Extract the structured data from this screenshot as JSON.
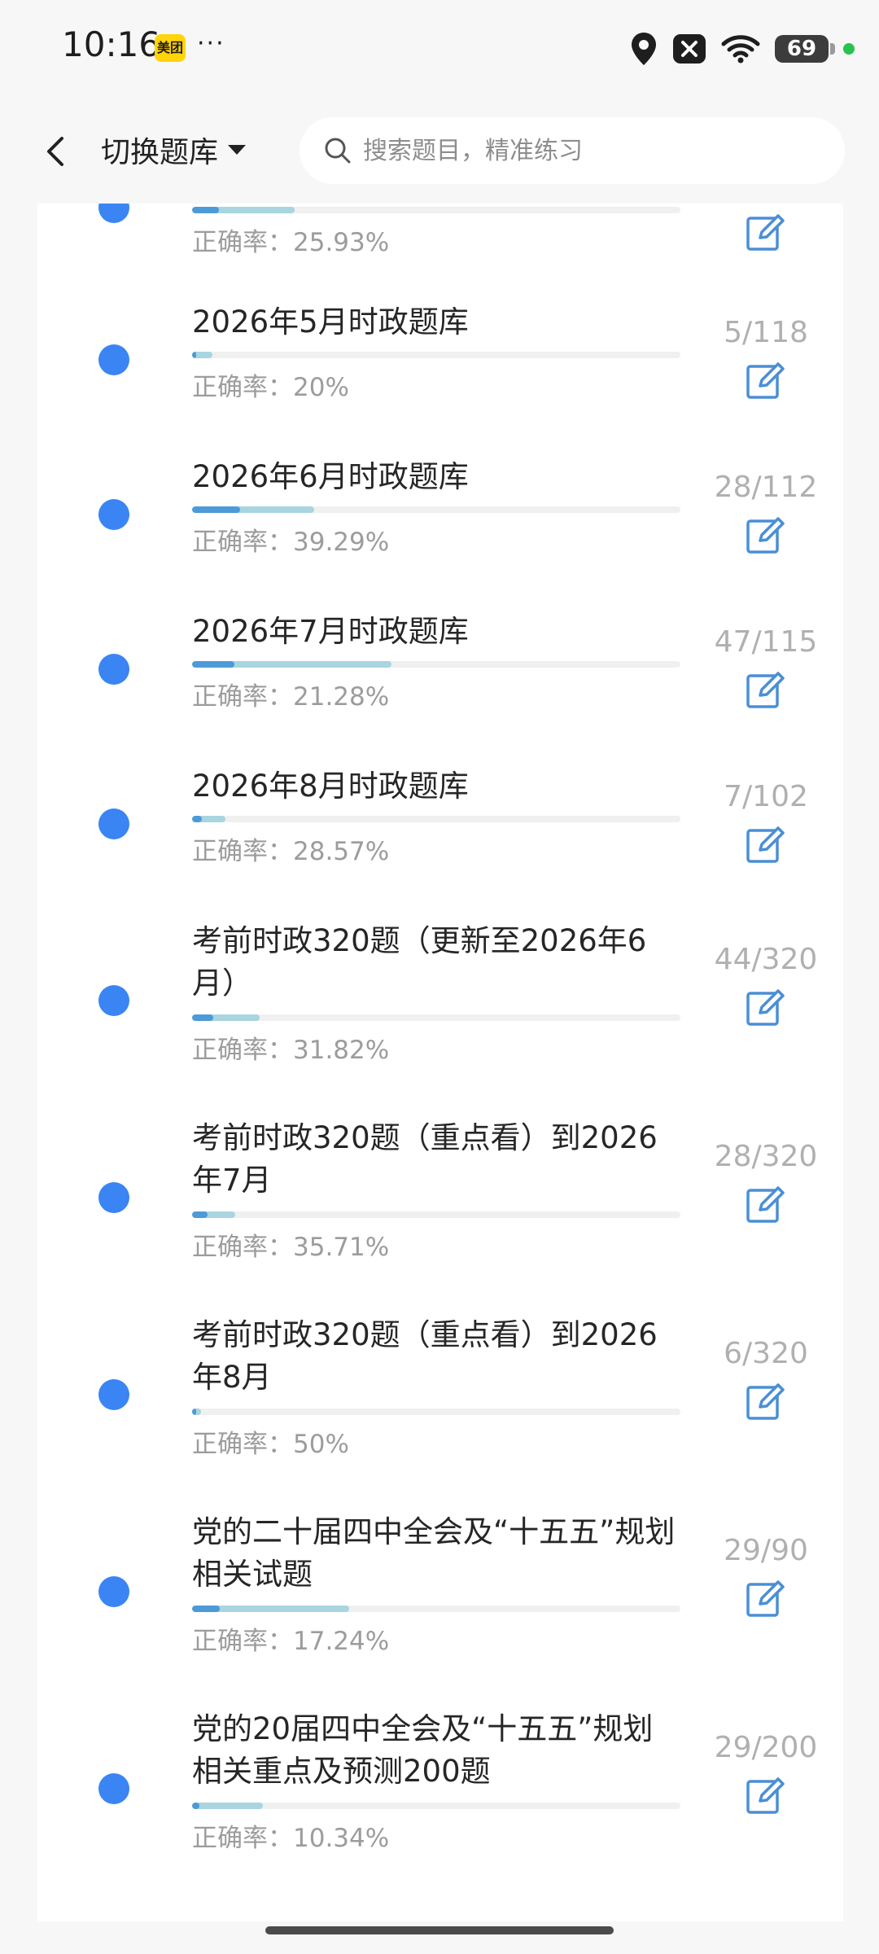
{
  "status_bar": {
    "time": "10:16",
    "app_badge": "美团",
    "more": "···",
    "battery": "69"
  },
  "top_bar": {
    "switch_label": "切换题库",
    "search_placeholder": "搜索题目，精准练习"
  },
  "accuracy_prefix": "正确率：",
  "items": [
    {
      "title": "",
      "accuracy": "25.93%",
      "count": ""
    },
    {
      "title": "2026年5月时政题库",
      "accuracy": "20%",
      "count": "5/118"
    },
    {
      "title": "2026年6月时政题库",
      "accuracy": "39.29%",
      "count": "28/112"
    },
    {
      "title": "2026年7月时政题库",
      "accuracy": "21.28%",
      "count": "47/115"
    },
    {
      "title": "2026年8月时政题库",
      "accuracy": "28.57%",
      "count": "7/102"
    },
    {
      "title": "考前时政320题（更新至2026年6月）",
      "accuracy": "31.82%",
      "count": "44/320"
    },
    {
      "title": "考前时政320题（重点看）到2026年7月",
      "accuracy": "35.71%",
      "count": "28/320"
    },
    {
      "title": "考前时政320题（重点看）到2026年8月",
      "accuracy": "50%",
      "count": "6/320"
    },
    {
      "title": "党的二十届四中全会及“十五五”规划相关试题",
      "accuracy": "17.24%",
      "count": "29/90"
    },
    {
      "title": "党的20届四中全会及“十五五”规划相关重点及预测200题",
      "accuracy": "10.34%",
      "count": "29/200"
    }
  ],
  "progress": [
    {
      "answered": 0.21,
      "correct": 0.055
    },
    {
      "answered": 0.042,
      "correct": 0.008
    },
    {
      "answered": 0.25,
      "correct": 0.098
    },
    {
      "answered": 0.409,
      "correct": 0.087
    },
    {
      "answered": 0.069,
      "correct": 0.02
    },
    {
      "answered": 0.1375,
      "correct": 0.044
    },
    {
      "answered": 0.0875,
      "correct": 0.031
    },
    {
      "answered": 0.019,
      "correct": 0.009
    },
    {
      "answered": 0.322,
      "correct": 0.056
    },
    {
      "answered": 0.145,
      "correct": 0.015
    }
  ],
  "colors": {
    "dot": "#3a85f3",
    "answered_bar": "#a8d5df",
    "correct_bar": "#4d9ad8",
    "edit_icon": "#4a8fd6"
  }
}
